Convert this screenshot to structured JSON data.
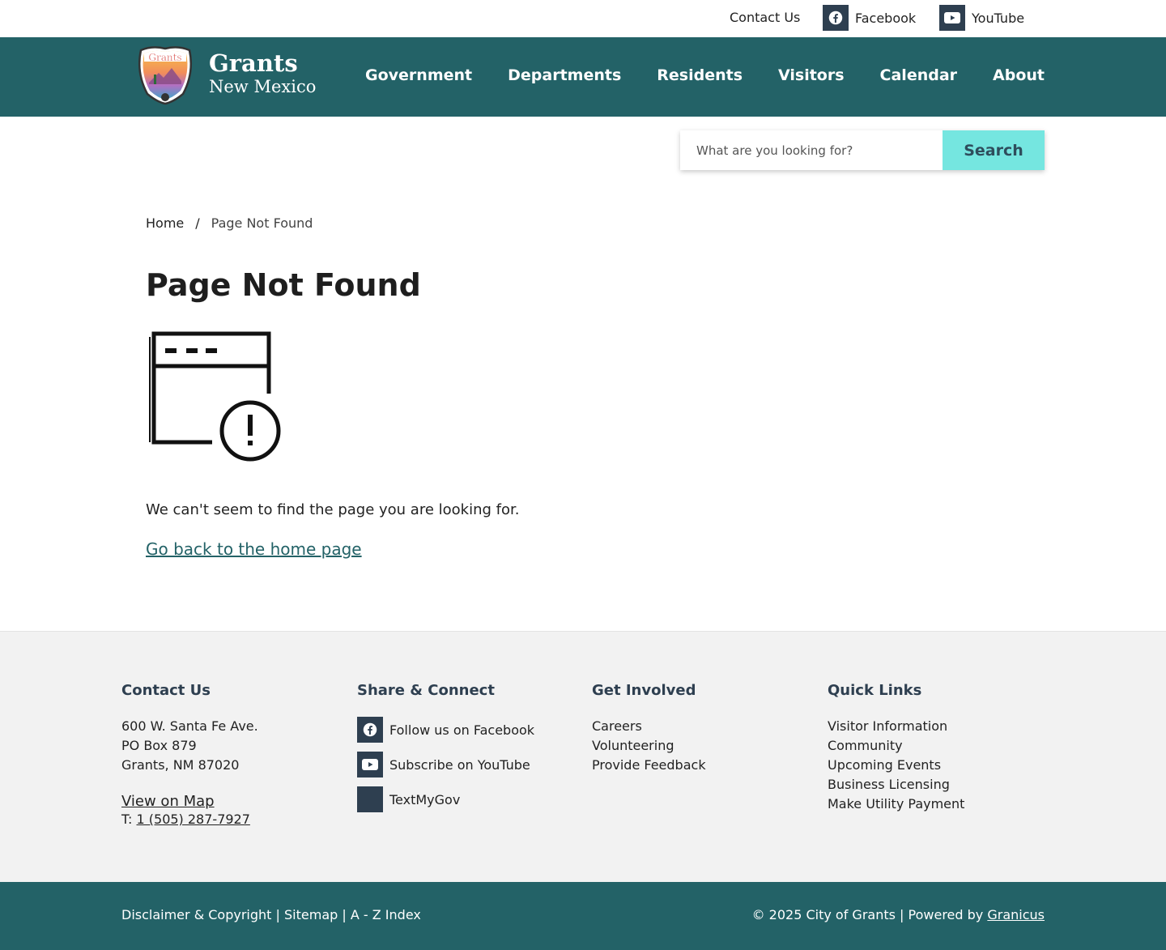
{
  "util": {
    "contact": "Contact Us",
    "facebook": "Facebook",
    "youtube": "YouTube"
  },
  "brand": {
    "shield_text": "Grants",
    "name": "Grants",
    "sub": "New Mexico"
  },
  "nav": {
    "items": [
      "Government",
      "Departments",
      "Residents",
      "Visitors",
      "Calendar",
      "About"
    ]
  },
  "search": {
    "placeholder": "What are you looking for?",
    "button": "Search"
  },
  "breadcrumb": {
    "home": "Home",
    "sep": "/",
    "current": "Page Not Found"
  },
  "main": {
    "title": "Page Not Found",
    "message": "We can't seem to find the page you are looking for.",
    "home_link": "Go back to the home page"
  },
  "footer": {
    "contact": {
      "heading": "Contact Us",
      "address1": "600 W. Santa Fe Ave.",
      "address2": "PO Box 879",
      "address3": "Grants, NM 87020",
      "map": "View on Map",
      "phone_prefix": "T:",
      "phone": "1 (505) 287-7927"
    },
    "share": {
      "heading": "Share & Connect",
      "facebook": "Follow us on Facebook",
      "youtube": "Subscribe on YouTube",
      "textmygov": "TextMyGov"
    },
    "involved": {
      "heading": "Get Involved",
      "items": [
        "Careers",
        "Volunteering",
        "Provide Feedback"
      ]
    },
    "quick": {
      "heading": "Quick Links",
      "items": [
        "Visitor Information",
        "Community",
        "Upcoming Events",
        "Business Licensing",
        "Make Utility Payment"
      ]
    }
  },
  "bottom": {
    "disclaimer": "Disclaimer & Copyright",
    "sitemap": "Sitemap",
    "az": "A - Z Index",
    "sep": "|",
    "copyright": "© 2025 City of Grants",
    "powered": "| Powered by",
    "granicus": "Granicus"
  },
  "colors": {
    "header": "#236267",
    "search_button": "#75e6e0",
    "icon_square": "#2e3f50",
    "footer_bg": "#f2f2f2"
  },
  "icons": [
    "facebook-icon",
    "youtube-icon",
    "textmygov-icon",
    "browser-error-icon",
    "grants-shield-logo"
  ]
}
